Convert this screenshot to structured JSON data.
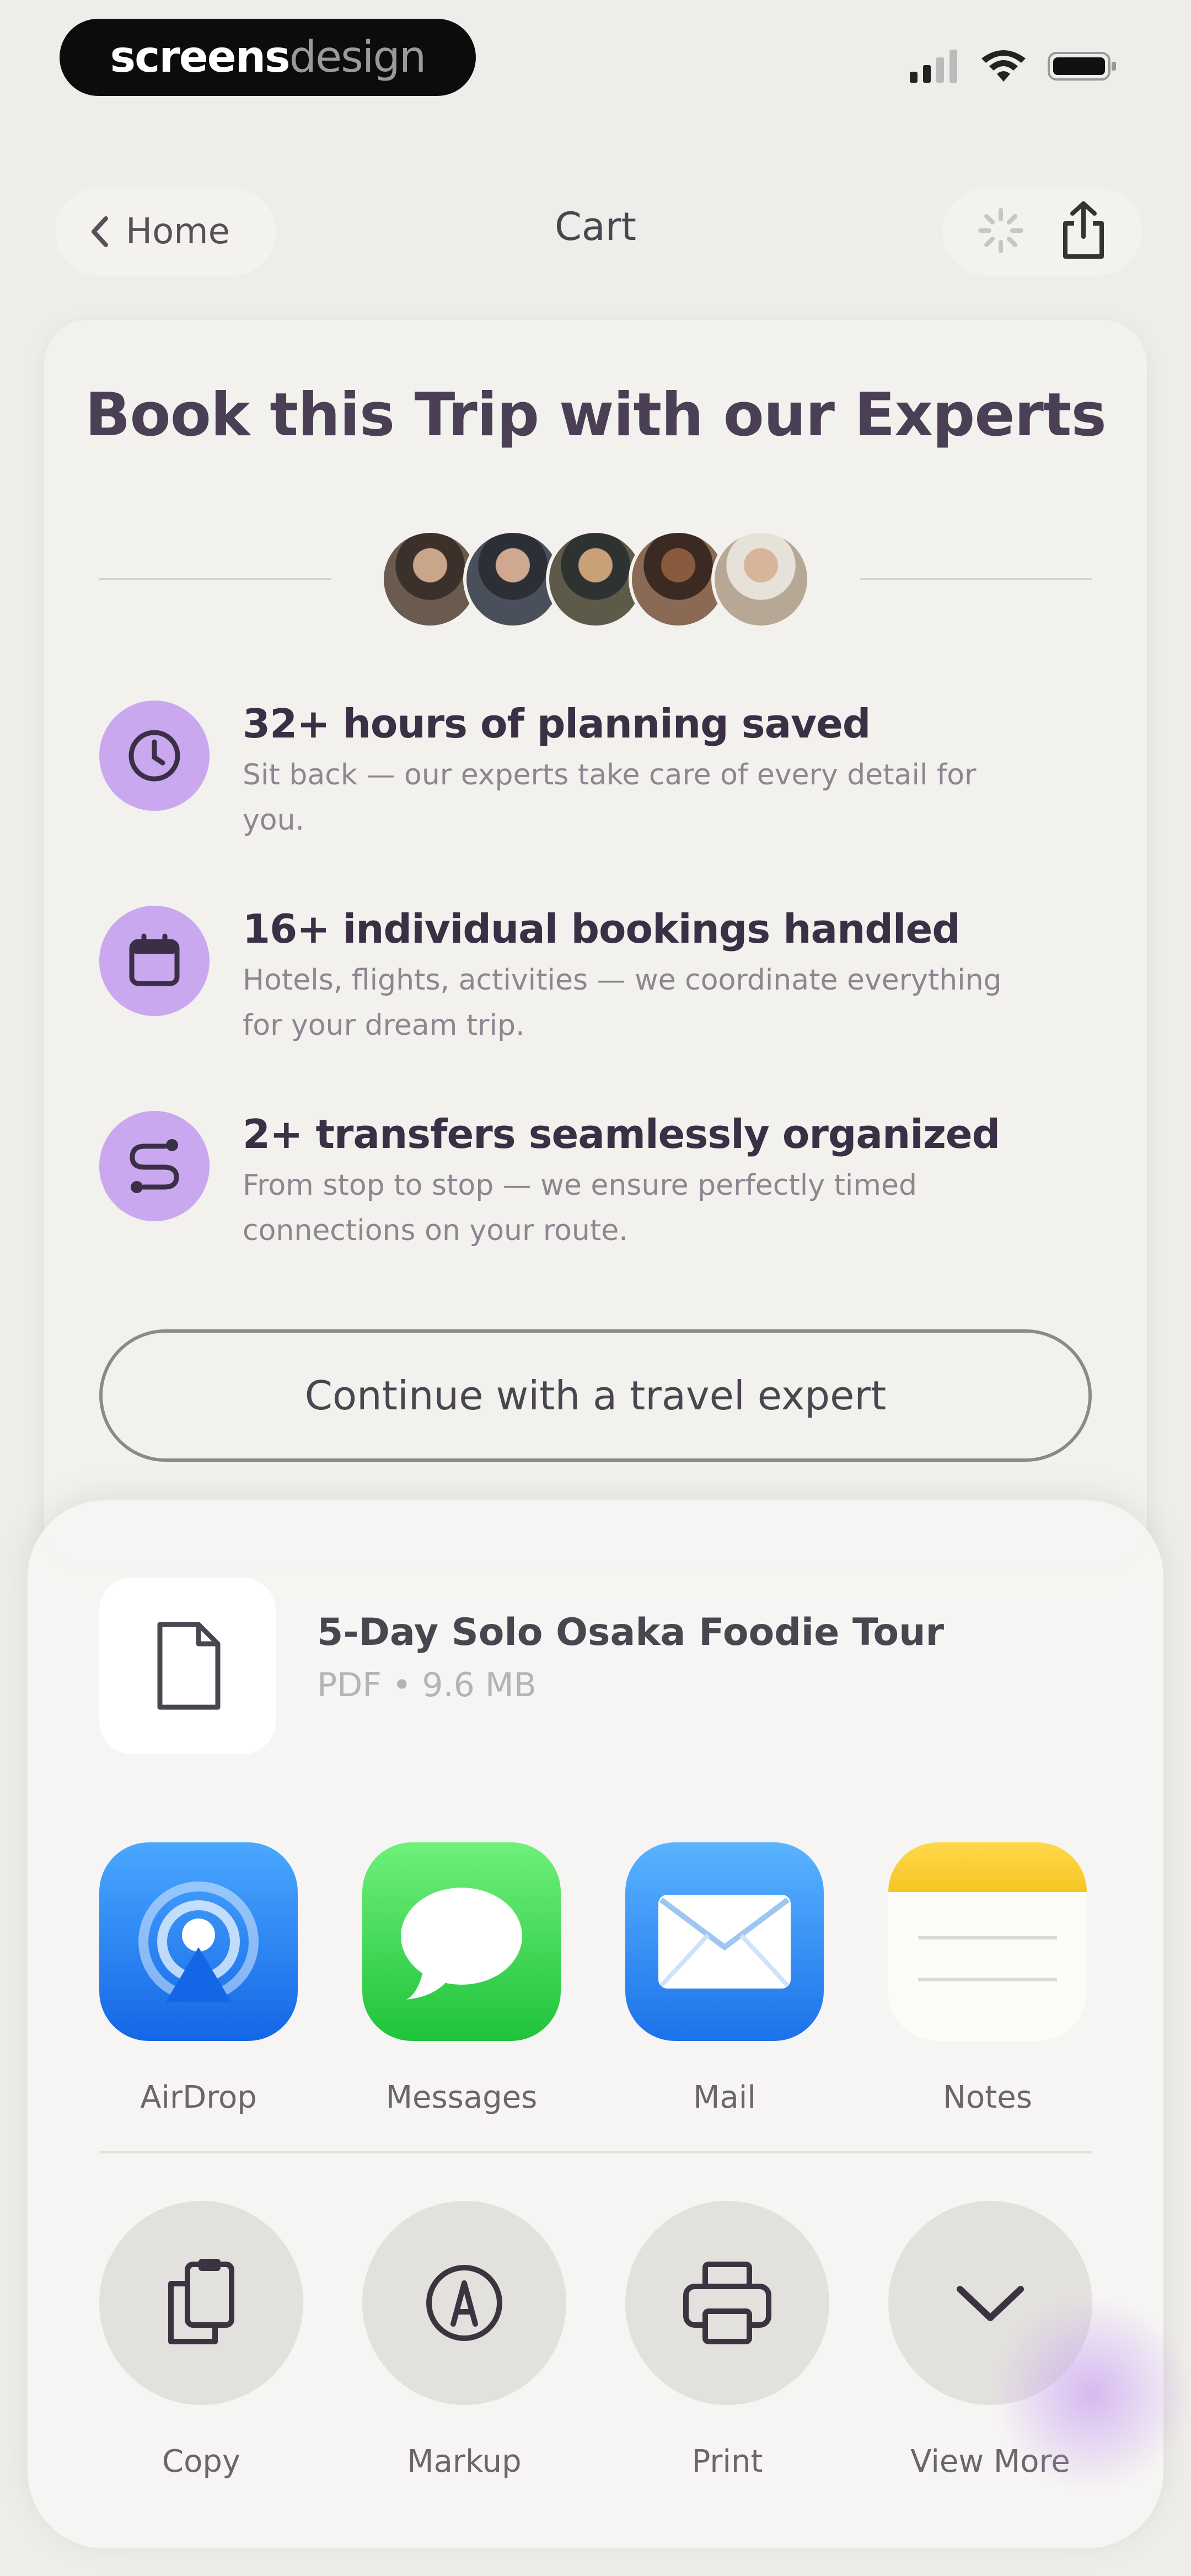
{
  "status_bar": {
    "logo_part1": "screens",
    "logo_part2": "design"
  },
  "nav": {
    "back_label": "Home",
    "title": "Cart"
  },
  "card": {
    "title": "Book this Trip with our Experts",
    "avatars": [
      "#6b5a4e",
      "#4a4f5c",
      "#5d5a4a",
      "#8a6a54",
      "#b7a896"
    ],
    "features": [
      {
        "icon": "clock-icon",
        "title": "32+ hours of planning saved",
        "desc_line1": "Sit back — our experts take care of every detail for",
        "desc_line2": "you."
      },
      {
        "icon": "calendar-icon",
        "title": "16+ individual bookings handled",
        "desc_line1": "Hotels, flights, activities — we coordinate everything",
        "desc_line2": "for your dream trip."
      },
      {
        "icon": "route-icon",
        "title": "2+ transfers seamlessly organized",
        "desc_line1": "From stop to stop — we ensure perfectly timed",
        "desc_line2": "connections on your route."
      }
    ],
    "cta_label": "Continue with a travel expert",
    "accent_color": "#c9a8ef"
  },
  "share_sheet": {
    "file_name": "5-Day Solo Osaka Foodie Tour",
    "file_meta": "PDF • 9.6 MB",
    "apps": [
      {
        "label": "AirDrop",
        "icon": "airdrop-icon"
      },
      {
        "label": "Messages",
        "icon": "messages-icon"
      },
      {
        "label": "Mail",
        "icon": "mail-icon"
      },
      {
        "label": "Notes",
        "icon": "notes-icon"
      }
    ],
    "actions": [
      {
        "label": "Copy",
        "icon": "copy-icon"
      },
      {
        "label": "Markup",
        "icon": "markup-icon"
      },
      {
        "label": "Print",
        "icon": "print-icon"
      },
      {
        "label": "View More",
        "icon": "chevron-down-icon"
      }
    ]
  }
}
